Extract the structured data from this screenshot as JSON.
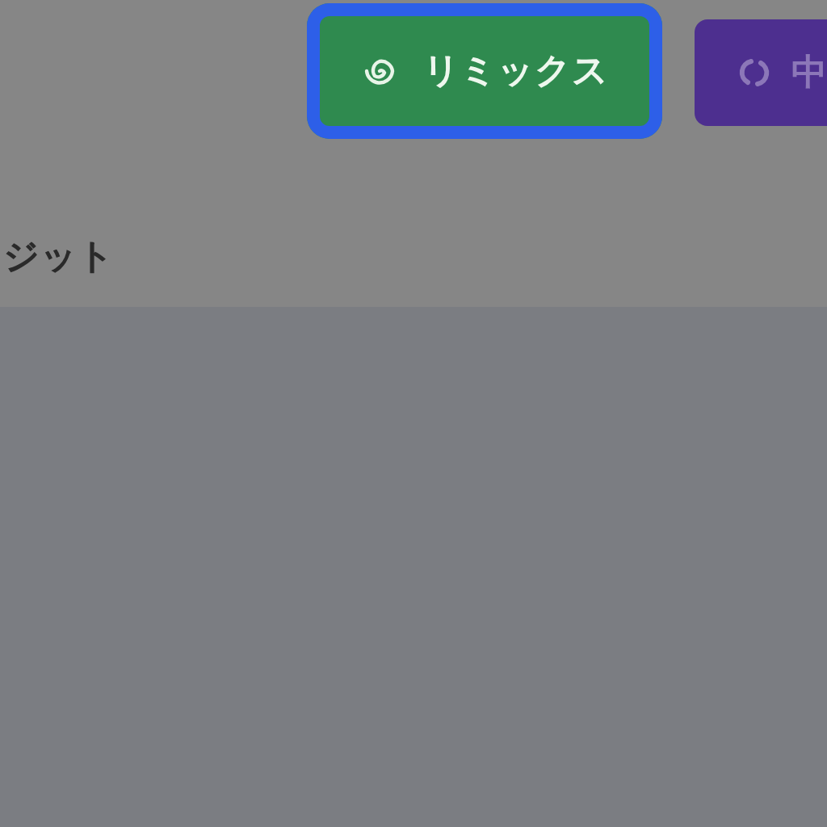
{
  "toolbar": {
    "buttons": [
      {
        "kind": "remix",
        "label": "リミックス",
        "focused": true
      },
      {
        "kind": "swap",
        "label": "中",
        "focused": false
      }
    ]
  },
  "section": {
    "title": "ジット"
  }
}
